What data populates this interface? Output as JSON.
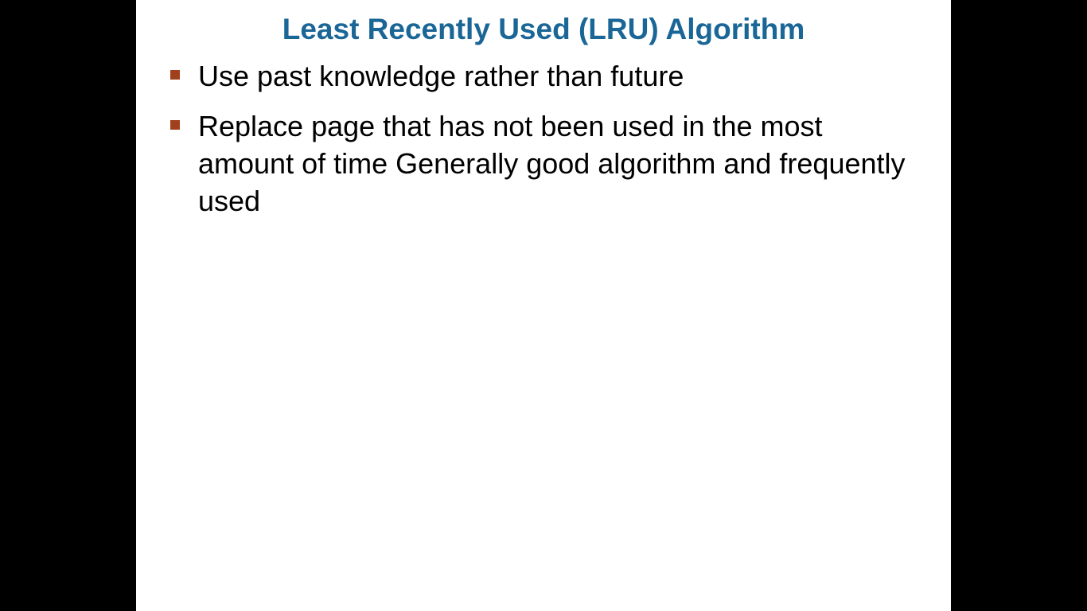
{
  "slide": {
    "title": "Least Recently Used (LRU) Algorithm",
    "bullets": [
      {
        "text": "Use past knowledge rather than future"
      },
      {
        "text": "Replace page that has not been used in the most amount of time Generally good algorithm and frequently used"
      }
    ]
  },
  "colors": {
    "title": "#1a6696",
    "bullet_marker": "#a0401c",
    "background": "#000000",
    "slide": "#ffffff"
  }
}
